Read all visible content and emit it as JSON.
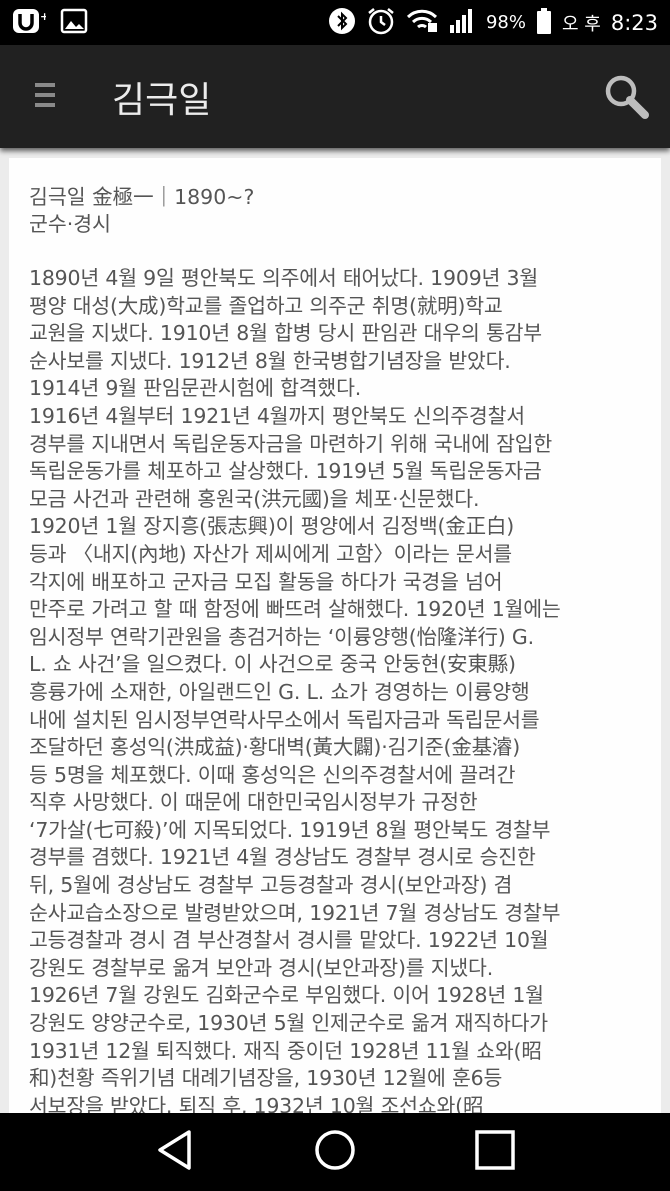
{
  "status_bar": {
    "battery": "98%",
    "ampm": "오 후",
    "time": "8:23",
    "icons": [
      "app-u-icon",
      "gallery-icon",
      "bluetooth-icon",
      "alarm-icon",
      "wifi-icon",
      "signal-icon",
      "battery-icon"
    ]
  },
  "app_bar": {
    "title": "김극일",
    "icons": [
      "menu-icon",
      "search-icon"
    ]
  },
  "article": {
    "heading": "김극일 金極一｜1890~?",
    "role": "군수·경시",
    "lines": [
      "1890년 4월 9일 평안북도 의주에서 태어났다. 1909년 3월",
      "평양 대성(大成)학교를 졸업하고 의주군 취명(就明)학교",
      "교원을 지냈다. 1910년 8월 합병 당시 판임관 대우의 통감부",
      "순사보를 지냈다. 1912년 8월 한국병합기념장을 받았다.",
      "1914년 9월 판임문관시험에 합격했다.",
      "1916년 4월부터 1921년 4월까지 평안북도 신의주경찰서",
      "경부를 지내면서 독립운동자금을 마련하기 위해 국내에 잠입한",
      "독립운동가를 체포하고 살상했다. 1919년 5월 독립운동자금",
      "모금 사건과 관련해 홍원국(洪元國)을 체포·신문했다.",
      "1920년 1월 장지흥(張志興)이 평양에서 김정백(金正白)",
      "등과 〈내지(內地) 자산가 제씨에게 고함〉이라는 문서를",
      "각지에 배포하고 군자금 모집 활동을 하다가 국경을 넘어",
      "만주로 가려고 할 때 함정에 빠뜨려 살해했다. 1920년 1월에는",
      "임시정부 연락기관원을 총검거하는 ‘이륭양행(怡隆洋行) G.",
      "L. 쇼 사건’을 일으켰다. 이 사건으로 중국 안둥현(安東縣)",
      "흥륭가에 소재한, 아일랜드인 G. L. 쇼가 경영하는 이륭양행",
      "내에 설치된 임시정부연락사무소에서 독립자금과 독립문서를",
      "조달하던 홍성익(洪成益)·황대벽(黃大闢)·김기준(金基濬)",
      "등 5명을 체포했다. 이때 홍성익은 신의주경찰서에 끌려간",
      "직후 사망했다. 이 때문에 대한민국임시정부가 규정한",
      "‘7가살(七可殺)’에 지목되었다. 1919년 8월 평안북도 경찰부",
      "경부를 겸했다. 1921년 4월 경상남도 경찰부 경시로 승진한",
      "뒤, 5월에 경상남도 경찰부 고등경찰과 경시(보안과장) 겸",
      "순사교습소장으로 발령받았으며, 1921년 7월 경상남도 경찰부",
      "고등경찰과 경시 겸 부산경찰서 경시를 맡았다. 1922년 10월",
      "강원도 경찰부로 옮겨 보안과 경시(보안과장)를 지냈다.",
      "1926년 7월 강원도 김화군수로 부임했다. 이어 1928년 1월",
      "강원도 양양군수로, 1930년 5월 인제군수로 옮겨 재직하다가",
      "1931년 12월 퇴직했다. 재직 중이던 1928년 11월 쇼와(昭",
      "和)천황 즉위기념 대례기념장을, 1930년 12월에 훈6등",
      "서보장을 받았다. 퇴직 후, 1932년 10월 조선쇼와(昭"
    ]
  },
  "nav_bar": {
    "icons": [
      "back-icon",
      "home-icon",
      "recents-icon"
    ]
  },
  "colors": {
    "status_bg": "#000000",
    "appbar_bg": "#212121",
    "content_bg": "#ececec",
    "card_bg": "#fefefe",
    "text": "#555555"
  }
}
